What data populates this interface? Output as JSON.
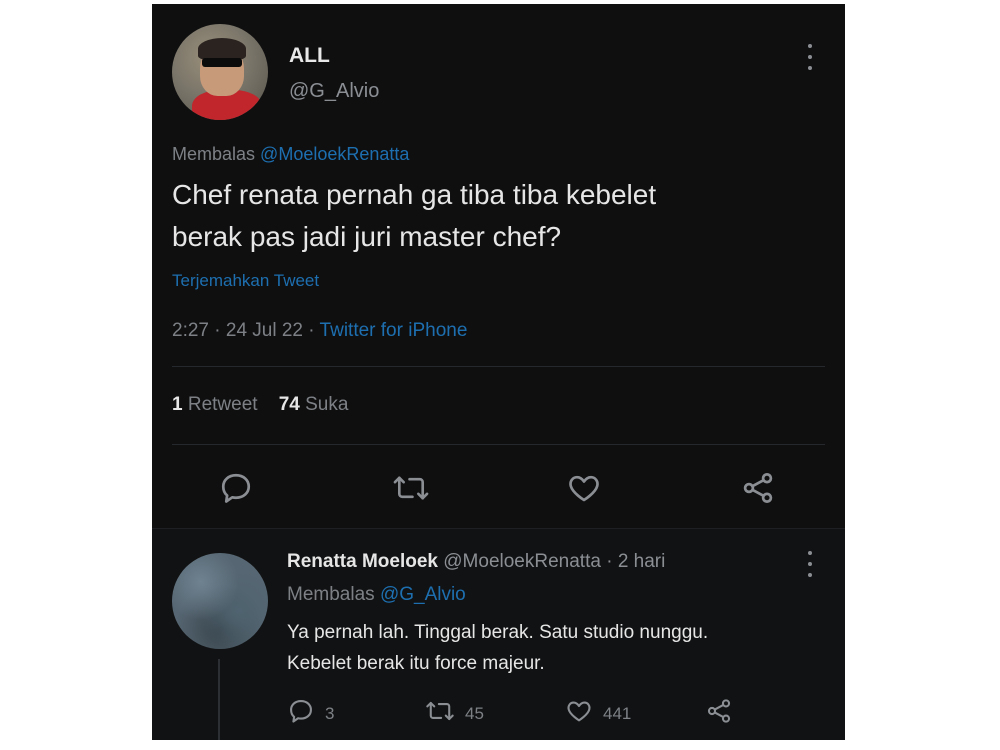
{
  "main_tweet": {
    "display_name": "ALL",
    "handle": "@G_Alvio",
    "reply_prefix": "Membalas",
    "reply_to": "@MoeloekRenatta",
    "text_line1": "Chef renata pernah ga tiba tiba kebelet",
    "text_line2": "berak pas jadi juri master chef?",
    "translate_label": "Terjemahkan Tweet",
    "time": "2:27",
    "date": "24 Jul 22",
    "separator": "·",
    "source": "Twitter for iPhone",
    "retweet_count": "1",
    "retweet_label": "Retweet",
    "like_count": "74",
    "like_label": "Suka",
    "actions": [
      "reply-icon",
      "retweet-icon",
      "like-icon",
      "share-icon"
    ]
  },
  "reply_tweet": {
    "display_name": "Renatta Moeloek",
    "handle": "@MoeloekRenatta",
    "separator": "·",
    "age": "2 hari",
    "reply_prefix": "Membalas",
    "reply_to": "@G_Alvio",
    "text_line1": "Ya pernah lah. Tinggal berak. Satu studio nunggu.",
    "text_line2": "Kebelet berak itu force majeur.",
    "reply_count": "3",
    "retweet_count": "45",
    "like_count": "441"
  },
  "colors": {
    "background": "#0f0f10",
    "primary_text": "#e6e6e6",
    "secondary_text": "#7d8186",
    "link": "#1d6fb0"
  }
}
